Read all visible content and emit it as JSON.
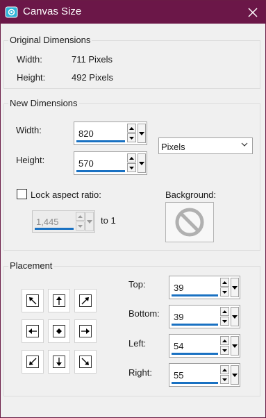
{
  "window": {
    "title": "Canvas Size"
  },
  "original": {
    "title": "Original Dimensions",
    "width_label": "Width:",
    "width_value": "711 Pixels",
    "height_label": "Height:",
    "height_value": "492 Pixels"
  },
  "new_dims": {
    "title": "New Dimensions",
    "width_label": "Width:",
    "width_value": "820",
    "height_label": "Height:",
    "height_value": "570",
    "units": "Pixels",
    "lock_label": "Lock aspect ratio:",
    "lock_checked": false,
    "ratio_value": "1,445",
    "ratio_suffix": "to 1",
    "background_label": "Background:"
  },
  "placement": {
    "title": "Placement",
    "top_label": "Top:",
    "top_value": "39",
    "bottom_label": "Bottom:",
    "bottom_value": "39",
    "left_label": "Left:",
    "left_value": "54",
    "right_label": "Right:",
    "right_value": "55"
  },
  "colors": {
    "titlebar": "#6b1748",
    "accent": "#1971c2"
  }
}
